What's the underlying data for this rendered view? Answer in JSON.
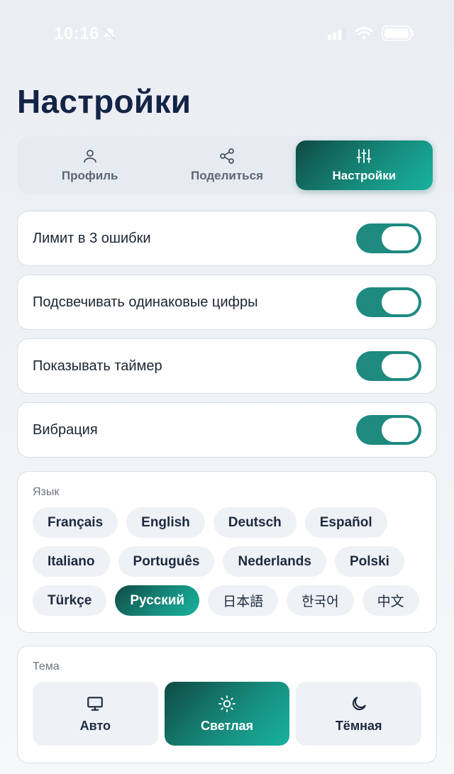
{
  "status_bar": {
    "time": "10:16"
  },
  "page": {
    "title": "Настройки"
  },
  "tabs": [
    {
      "label": "Профиль",
      "icon": "user-icon",
      "active": false
    },
    {
      "label": "Поделиться",
      "icon": "share-icon",
      "active": false
    },
    {
      "label": "Настройки",
      "icon": "sliders-icon",
      "active": true
    }
  ],
  "toggles": [
    {
      "label": "Лимит в 3 ошибки",
      "on": true
    },
    {
      "label": "Подсвечивать одинаковые цифры",
      "on": true
    },
    {
      "label": "Показывать таймер",
      "on": true
    },
    {
      "label": "Вибрация",
      "on": true
    }
  ],
  "language": {
    "label": "Язык",
    "options": [
      "Français",
      "English",
      "Deutsch",
      "Español",
      "Italiano",
      "Português",
      "Nederlands",
      "Polski",
      "Türkçe",
      "Русский",
      "日本語",
      "한국어",
      "中文"
    ],
    "selected": "Русский"
  },
  "theme": {
    "label": "Тема",
    "options": [
      {
        "label": "Авто",
        "icon": "monitor-icon"
      },
      {
        "label": "Светлая",
        "icon": "sun-icon"
      },
      {
        "label": "Тёмная",
        "icon": "moon-icon"
      }
    ],
    "selected": "Светлая"
  },
  "colors": {
    "accent": "#168a7c",
    "title": "#142447",
    "toggle_on": "#1f8a80"
  }
}
